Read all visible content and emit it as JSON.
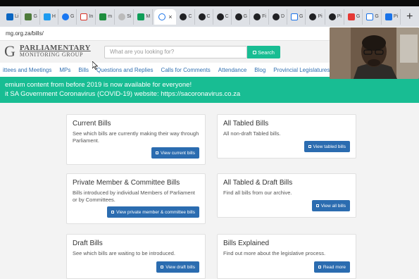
{
  "browser": {
    "tabs": [
      {
        "label": "Li",
        "color": "#0a66c2"
      },
      {
        "label": "G",
        "color": "#4d7a3a"
      },
      {
        "label": "H",
        "color": "#1d9bf0"
      },
      {
        "label": "G",
        "color": "#1877f2"
      },
      {
        "label": "In",
        "color": "#d93025"
      },
      {
        "label": "m",
        "color": "#1e8e3e"
      },
      {
        "label": "Si",
        "color": "#888888"
      },
      {
        "label": "M",
        "color": "#0f9d58"
      }
    ],
    "active_tab": {
      "label": "×"
    },
    "more_tabs": [
      {
        "label": "C",
        "color": "#202124"
      },
      {
        "label": "C",
        "color": "#202124"
      },
      {
        "label": "C",
        "color": "#202124"
      },
      {
        "label": "G",
        "color": "#202124"
      },
      {
        "label": "Fi",
        "color": "#202124"
      },
      {
        "label": "D",
        "color": "#202124"
      },
      {
        "label": "G",
        "color": "#1a73e8"
      },
      {
        "label": "Pi",
        "color": "#202124"
      },
      {
        "label": "Pi",
        "color": "#202124"
      },
      {
        "label": "G",
        "color": "#e53935"
      },
      {
        "label": "G",
        "color": "#1a73e8"
      },
      {
        "label": "Pi",
        "color": "#1a73e8"
      }
    ],
    "newtab_label": "+",
    "url": "mg.org.za/bills/"
  },
  "header": {
    "logo_letter": "G",
    "logo_line1": "PARLIAMENTARY",
    "logo_line2": "MONITORING GROUP",
    "search_placeholder": "What are you looking for?",
    "search_button": "Search"
  },
  "nav": {
    "items": [
      "ittees and Meetings",
      "MPs",
      "Bills",
      "Questions and Replies",
      "Calls for Comments",
      "Attendance",
      "Blog",
      "Provincial Legislatures"
    ]
  },
  "banner": {
    "line1": "emium content from before 2019 is now available for everyone!",
    "line2": "it SA Government Coronavirus (COVID-19) website: https://sacoronavirus.co.za"
  },
  "cards": [
    {
      "title": "Current Bills",
      "desc": "See which bills are currently making their way through Parliament.",
      "button": "View current bills"
    },
    {
      "title": "All Tabled Bills",
      "desc": "All non-draft Tabled bills.",
      "button": "View tabled bills"
    },
    {
      "title": "Private Member & Committee Bills",
      "desc": "Bills introduced by individual Members of Parliament or by Committees.",
      "button": "View private member & committee bills"
    },
    {
      "title": "All Tabled & Draft Bills",
      "desc": "Find all bills from our archive.",
      "button": "View all bills"
    },
    {
      "title": "Draft Bills",
      "desc": "See which bills are waiting to be introduced.",
      "button": "View draft bills"
    },
    {
      "title": "Bills Explained",
      "desc": "Find out more about the legislative process.",
      "button": "Read more"
    }
  ]
}
